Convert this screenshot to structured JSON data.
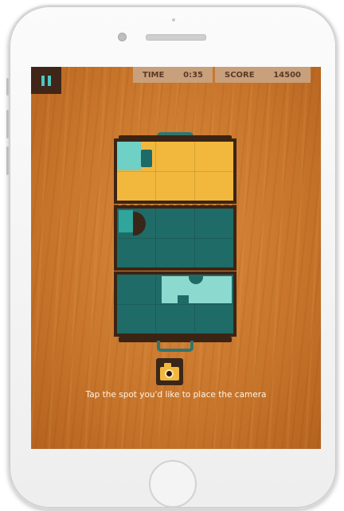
{
  "hud": {
    "time_label": "TIME",
    "time_value": "0:35",
    "score_label": "SCORE",
    "score_value": "14500"
  },
  "instruction": "Tap the spot you'd like to place the camera",
  "icons": {
    "pause": "pause-icon",
    "camera": "camera-icon"
  },
  "colors": {
    "board": "#c8752b",
    "case_yellow": "#f2b83e",
    "case_teal": "#1f6b68",
    "accent": "#6fd0c6",
    "frame": "#3c2414"
  }
}
